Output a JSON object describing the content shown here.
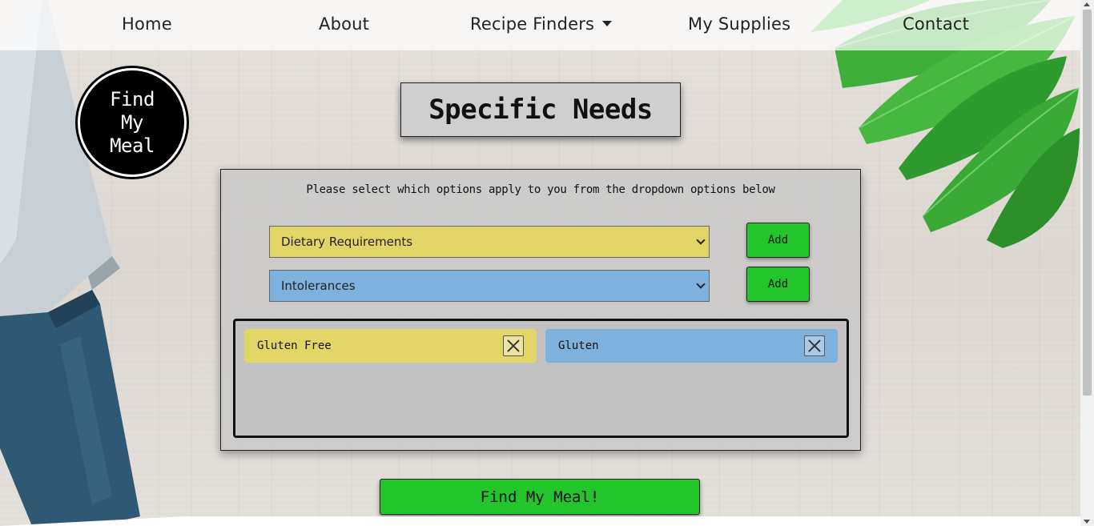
{
  "nav": {
    "items": [
      {
        "label": "Home"
      },
      {
        "label": "About"
      },
      {
        "label": "Recipe Finders"
      },
      {
        "label": "My Supplies"
      },
      {
        "label": "Contact"
      }
    ]
  },
  "logo": {
    "text": "Find\nMy\nMeal"
  },
  "page_title": "Specific Needs",
  "panel": {
    "instructions": "Please select which options apply to you from the dropdown options below",
    "dietary_select": {
      "selected": "Dietary Requirements",
      "color": "#e1d566"
    },
    "intolerances_select": {
      "selected": "Intolerances",
      "color": "#7fb1de"
    },
    "add_label": "Add",
    "selected_items": [
      {
        "label": "Gluten Free"
      },
      {
        "label": "Gluten"
      }
    ]
  },
  "find_button": "Find My Meal!",
  "colors": {
    "accent_green": "#22c52a",
    "dietary_yellow": "#e1d566",
    "intolerance_blue": "#7fb1de"
  }
}
